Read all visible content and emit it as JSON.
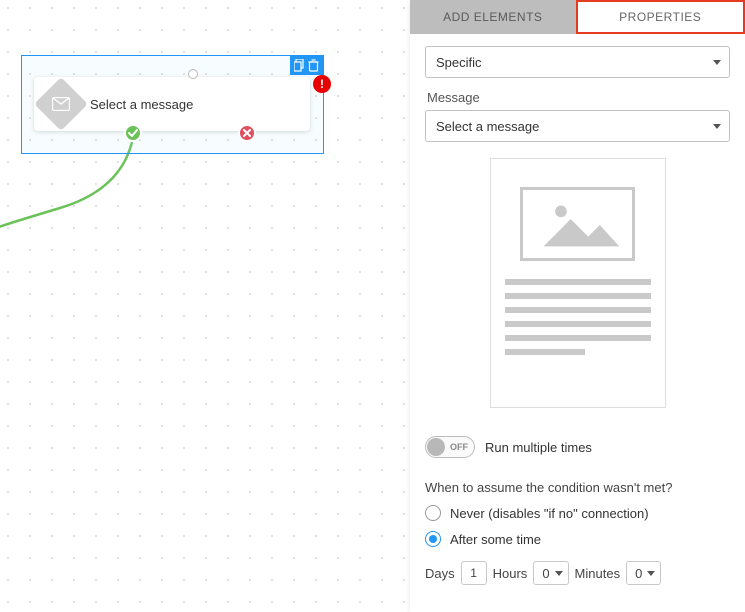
{
  "canvas": {
    "node": {
      "label": "Select a message",
      "warning": "!",
      "icon": "envelope-icon"
    }
  },
  "tabs": {
    "add_elements": "ADD ELEMENTS",
    "properties": "PROPERTIES"
  },
  "properties": {
    "type_dropdown": "Specific",
    "message_label": "Message",
    "message_dropdown": "Select a message",
    "toggle_state": "OFF",
    "toggle_label": "Run multiple times",
    "condition_question": "When to assume the condition wasn't met?",
    "radio_never": "Never (disables \"if no\" connection)",
    "radio_after": "After some time",
    "time": {
      "days_label": "Days",
      "days_value": "1",
      "hours_label": "Hours",
      "hours_value": "0",
      "minutes_label": "Minutes",
      "minutes_value": "0"
    }
  }
}
